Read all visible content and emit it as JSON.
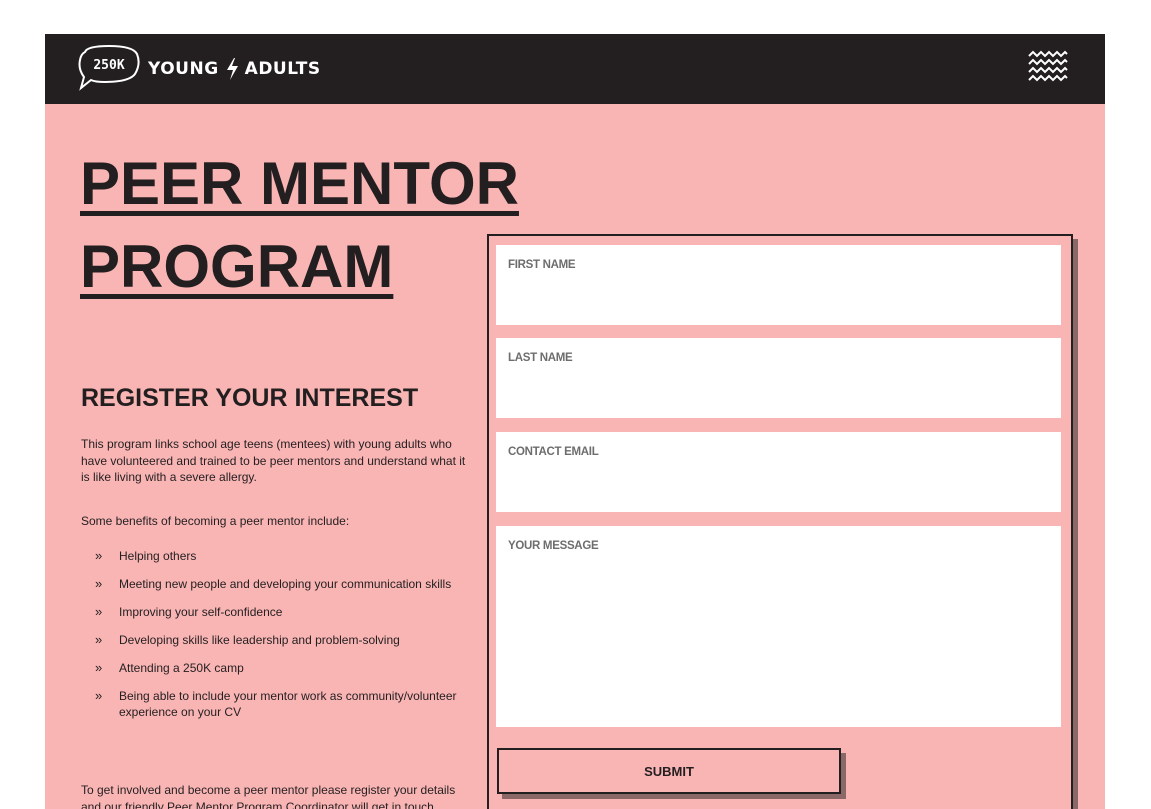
{
  "header": {
    "logo_text": "250K",
    "brand_left": "YOUNG",
    "brand_right": "ADULTS",
    "menu_icon": "zigzag-menu-icon",
    "colors": {
      "bar": "#231f20",
      "text": "#ffffff"
    }
  },
  "hero": {
    "title_line1": "PEER MENTOR",
    "title_line2": "PROGRAM"
  },
  "content": {
    "section_title": "REGISTER YOUR INTEREST",
    "intro": "This program links school age teens (mentees) with young adults who have volunteered and trained to be peer mentors and understand what it is like living with a severe allergy.",
    "benefits_intro": "Some benefits of becoming a peer mentor include:",
    "bullet_glyph": "»",
    "benefits": [
      "Helping others",
      "Meeting new people and developing your communication skills",
      "Improving your self-confidence",
      "Developing skills like leadership and problem-solving",
      "Attending a 250K camp",
      "Being able to include your mentor work as community/volunteer experience on your CV"
    ],
    "outro": "To get involved and become a peer mentor please register your details and our friendly Peer Mentor Program Coordinator will get in touch."
  },
  "form": {
    "fields": [
      {
        "label": "FIRST NAME",
        "value": ""
      },
      {
        "label": "LAST NAME",
        "value": ""
      },
      {
        "label": "CONTACT EMAIL",
        "value": ""
      },
      {
        "label": "YOUR MESSAGE",
        "value": ""
      }
    ],
    "submit_label": "SUBMIT"
  },
  "colors": {
    "background": "#f9b4b4",
    "text": "#231f20",
    "field": "#ffffff",
    "field_label": "#6d6d6d",
    "shadow": "#8a6868"
  }
}
